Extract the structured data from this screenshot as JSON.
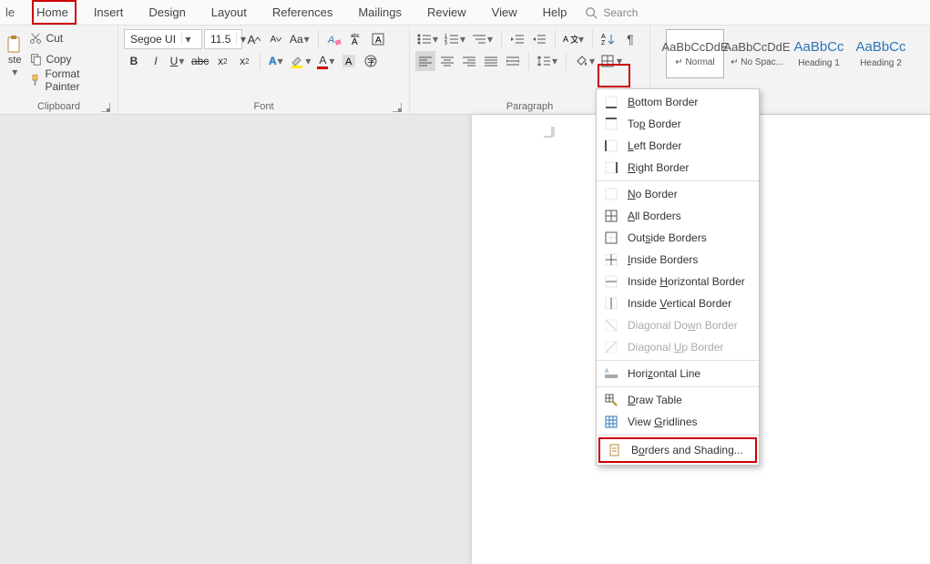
{
  "tabs": {
    "file": "le",
    "home": "Home",
    "insert": "Insert",
    "design": "Design",
    "layout": "Layout",
    "references": "References",
    "mailings": "Mailings",
    "review": "Review",
    "view": "View",
    "help": "Help",
    "search": "Search"
  },
  "clipboard": {
    "paste": "ste",
    "cut": "Cut",
    "copy": "Copy",
    "format_painter": "Format Painter",
    "label": "Clipboard"
  },
  "font": {
    "name": "Segoe UI",
    "size": "11.5",
    "label": "Font"
  },
  "paragraph": {
    "label": "Paragraph"
  },
  "styles": {
    "s1": {
      "prev": "AaBbCcDdE",
      "name": "↵ Normal"
    },
    "s2": {
      "prev": "AaBbCcDdE",
      "name": "↵ No Spac..."
    },
    "s3": {
      "prev": "AaBbCc",
      "name": "Heading 1"
    },
    "s4": {
      "prev": "AaBbCc",
      "name": "Heading 2"
    }
  },
  "menu": {
    "bottom": "Bottom Border",
    "top": "Top Border",
    "left": "Left Border",
    "right": "Right Border",
    "none": "No Border",
    "all": "All Borders",
    "outside": "Outside Borders",
    "inside": "Inside Borders",
    "inside_h": "Inside Horizontal Border",
    "inside_v": "Inside Vertical Border",
    "diag_down": "Diagonal Down Border",
    "diag_up": "Diagonal Up Border",
    "hline": "Horizontal Line",
    "draw": "Draw Table",
    "grid": "View Gridlines",
    "shading": "Borders and Shading..."
  }
}
